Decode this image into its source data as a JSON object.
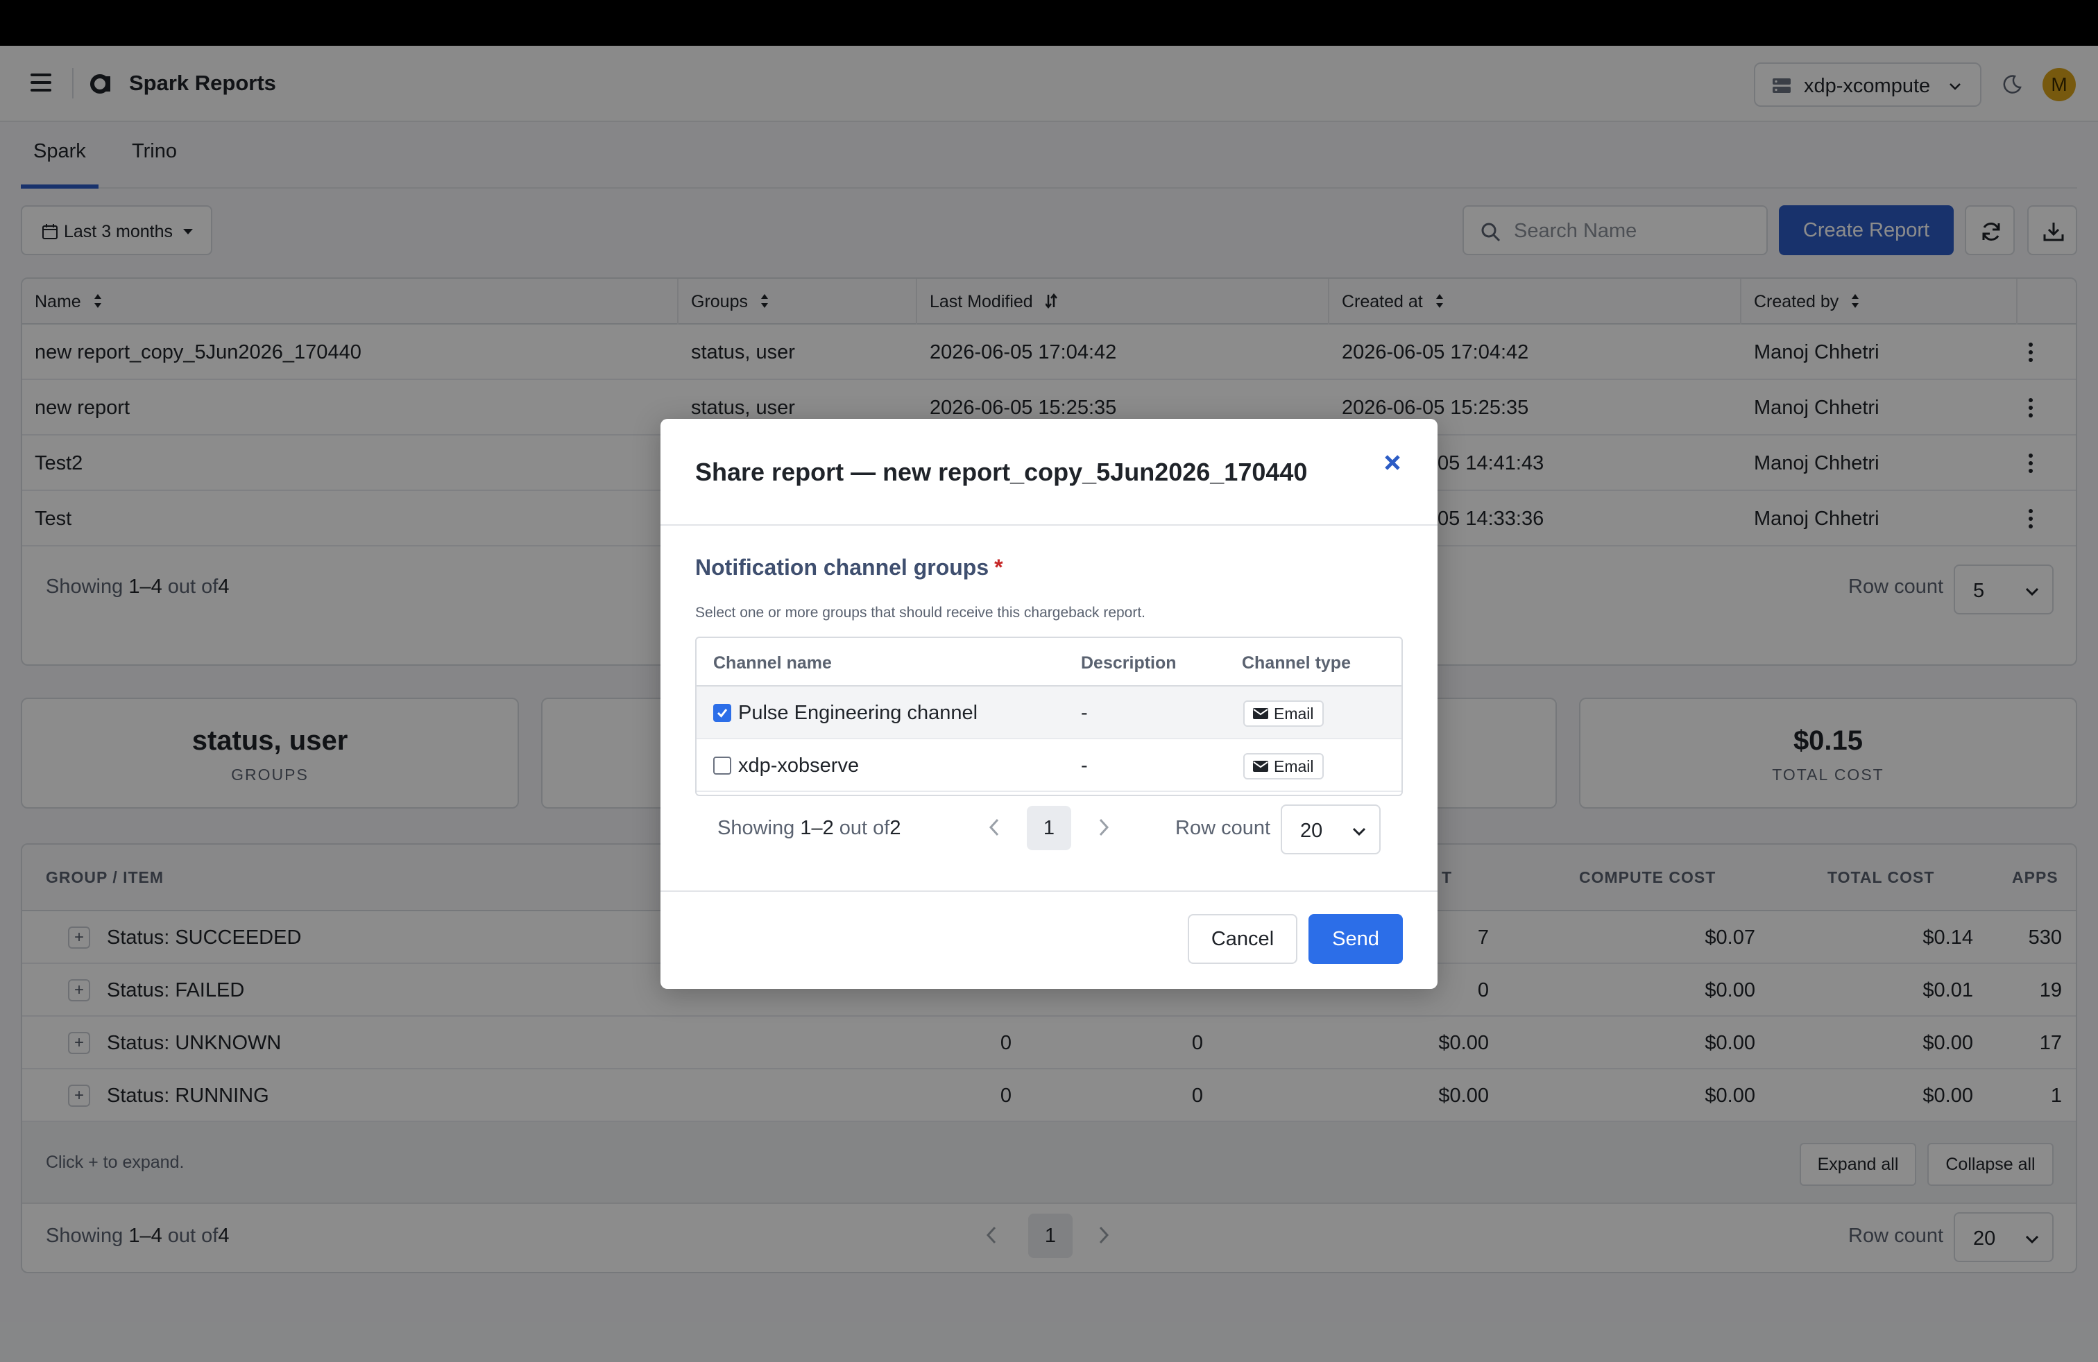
{
  "header": {
    "app_title": "Spark Reports",
    "workspace": "xdp-xcompute",
    "avatar_initial": "M"
  },
  "tabs": [
    {
      "label": "Spark",
      "active": true
    },
    {
      "label": "Trino",
      "active": false
    }
  ],
  "toolbar": {
    "date_range": "Last 3 months",
    "search_placeholder": "Search Name",
    "create_label": "Create Report"
  },
  "reports": {
    "columns": [
      "Name",
      "Groups",
      "Last Modified",
      "Created at",
      "Created by"
    ],
    "rows": [
      {
        "name": "new report_copy_5Jun2026_170440",
        "groups": "status, user",
        "modified": "2026-06-05 17:04:42",
        "created": "2026-06-05 17:04:42",
        "by": "Manoj Chhetri"
      },
      {
        "name": "new report",
        "groups": "status, user",
        "modified": "2026-06-05 15:25:35",
        "created": "2026-06-05 15:25:35",
        "by": "Manoj Chhetri"
      },
      {
        "name": "Test2",
        "groups": "",
        "modified": "",
        "created": "05 14:41:43",
        "by": "Manoj Chhetri"
      },
      {
        "name": "Test",
        "groups": "",
        "modified": "",
        "created": "05 14:33:36",
        "by": "Manoj Chhetri"
      }
    ],
    "showing_prefix": "Showing",
    "showing_range": "1–4",
    "showing_mid": "out of",
    "showing_total": "4",
    "row_count_label": "Row count",
    "row_count": "5"
  },
  "summary": {
    "groups_value": "status, user",
    "groups_label": "GROUPS",
    "total_cost_value": "$0.15",
    "total_cost_label": "TOTAL COST"
  },
  "groups_table": {
    "columns": {
      "group_item": "GROUP / ITEM",
      "partial": "T",
      "compute_cost": "COMPUTE COST",
      "total_cost": "TOTAL COST",
      "apps": "APPS"
    },
    "rows": [
      {
        "label": "Status: SUCCEEDED",
        "c1": "",
        "c2": "",
        "c3": "7",
        "compute": "$0.07",
        "total": "$0.14",
        "apps": "530"
      },
      {
        "label": "Status: FAILED",
        "c1": "",
        "c2": "",
        "c3": "0",
        "compute": "$0.00",
        "total": "$0.01",
        "apps": "19"
      },
      {
        "label": "Status: UNKNOWN",
        "c1": "0",
        "c2": "0",
        "c3": "$0.00",
        "compute": "$0.00",
        "total": "$0.00",
        "apps": "17"
      },
      {
        "label": "Status: RUNNING",
        "c1": "0",
        "c2": "0",
        "c3": "$0.00",
        "compute": "$0.00",
        "total": "$0.00",
        "apps": "1"
      }
    ],
    "hint": "Click + to expand.",
    "expand_all": "Expand all",
    "collapse_all": "Collapse all",
    "showing_prefix": "Showing",
    "showing_range": "1–4",
    "showing_mid": "out of",
    "showing_total": "4",
    "page": "1",
    "row_count_label": "Row count",
    "row_count": "20"
  },
  "modal": {
    "title": "Share report — new report_copy_5Jun2026_170440",
    "section_title": "Notification channel groups",
    "required_mark": "*",
    "help": "Select one or more groups that should receive this chargeback report.",
    "columns": [
      "Channel name",
      "Description",
      "Channel type"
    ],
    "channels": [
      {
        "name": "Pulse Engineering channel",
        "description": "-",
        "type": "Email",
        "checked": true
      },
      {
        "name": "xdp-xobserve",
        "description": "-",
        "type": "Email",
        "checked": false
      }
    ],
    "showing_prefix": "Showing",
    "showing_range": "1–2",
    "showing_mid": "out of",
    "showing_total": "2",
    "page": "1",
    "row_count_label": "Row count",
    "row_count": "20",
    "cancel_label": "Cancel",
    "send_label": "Send"
  },
  "colors": {
    "primary": "#2c5cc5",
    "send": "#2c6ee8",
    "avatar": "#d9a21b",
    "required": "#c62828"
  }
}
